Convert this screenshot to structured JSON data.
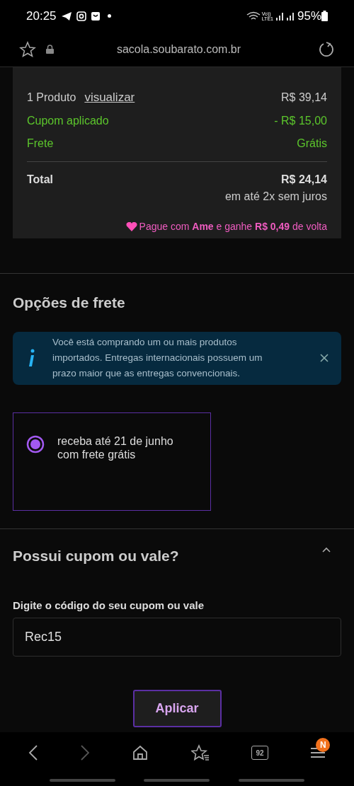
{
  "status_bar": {
    "time": "20:25",
    "volte_top": "Vo))",
    "volte_bottom": "LTE1",
    "battery": "95%"
  },
  "address_bar": {
    "url": "sacola.soubarato.com.br"
  },
  "summary": {
    "products": "1 Produto",
    "view_link": "visualizar",
    "products_price": "R$ 39,14",
    "lines": [
      {
        "label": "Cupom aplicado",
        "value": "- R$ 15,00"
      },
      {
        "label": "Frete",
        "value": "Grátis"
      }
    ],
    "total_label": "Total",
    "total_value": "R$ 24,14",
    "installments": "em até 2x sem juros",
    "cashback": "Pague com **Ame** e ganhe **R$ 0,49** de volta"
  },
  "shipping": {
    "title": "Opções de frete",
    "notice": "Você está comprando um ou mais produtos importados. Entregas internacionais possuem um prazo maior que as entregas convencionais.",
    "options": [
      {
        "label": "receba até 21 de junho com frete grátis",
        "selected": true
      }
    ]
  },
  "coupon": {
    "title": "Possui cupom ou vale?",
    "expanded": true,
    "field_label": "Digite o código do seu cupom ou vale",
    "value": "Rec15",
    "button": "Aplicar"
  },
  "bottom_nav": {
    "tabs_count": "92",
    "menu_badge": "N"
  }
}
